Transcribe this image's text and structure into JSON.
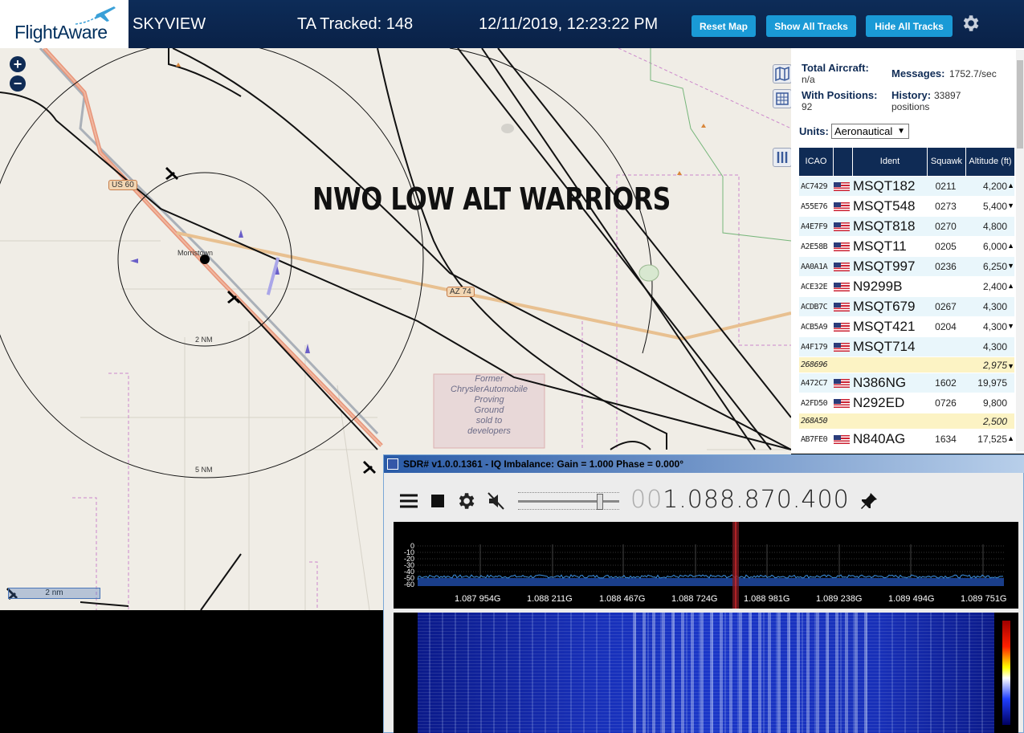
{
  "header": {
    "logo_text": "FlightAware",
    "app_name": "SKYVIEW",
    "tracked_label": "TA Tracked: 148",
    "datetime": "12/11/2019, 12:23:22 PM",
    "buttons": {
      "reset": "Reset Map",
      "show_all": "Show All Tracks",
      "hide_all": "Hide All Tracks"
    },
    "settings_icon": "gear-icon"
  },
  "map": {
    "zoom_in": "+",
    "zoom_out": "−",
    "overlay_title": "NWO LOW ALT WARRIORS",
    "place_label": "Morristown",
    "us60": "US 60",
    "az74": "AZ 74",
    "ring_small": "2 NM",
    "ring_large": "5 NM",
    "scale": "2 nm",
    "proving_ground": [
      "Former",
      "ChryslerAutomobile",
      "Proving",
      "Ground",
      "sold to",
      "developers"
    ]
  },
  "stats": {
    "total_aircraft_label": "Total Aircraft:",
    "total_aircraft_value": "n/a",
    "with_positions_label": "With Positions:",
    "with_positions_value": "92",
    "messages_label": "Messages:",
    "messages_value": "1752.7/sec",
    "history_label": "History:",
    "history_value": "33897",
    "history_unit": "positions",
    "units_label": "Units:",
    "units_value": "Aeronautical"
  },
  "table": {
    "headers": {
      "icao": "ICAO",
      "ident": "Ident",
      "squawk": "Squawk",
      "altitude": "Altitude (ft)"
    },
    "rows": [
      {
        "icao": "AC7429",
        "flag": true,
        "ident": "MSQT182",
        "squawk": "0211",
        "alt": "4,200",
        "trend": "▲"
      },
      {
        "icao": "A55E76",
        "flag": true,
        "ident": "MSQT548",
        "squawk": "0273",
        "alt": "5,400",
        "trend": "▼"
      },
      {
        "icao": "A4E7F9",
        "flag": true,
        "ident": "MSQT818",
        "squawk": "0270",
        "alt": "4,800",
        "trend": ""
      },
      {
        "icao": "A2E58B",
        "flag": true,
        "ident": "MSQT11",
        "squawk": "0205",
        "alt": "6,000",
        "trend": "▲"
      },
      {
        "icao": "AA0A1A",
        "flag": true,
        "ident": "MSQT997",
        "squawk": "0236",
        "alt": "6,250",
        "trend": "▼"
      },
      {
        "icao": "ACE32E",
        "flag": true,
        "ident": "N9299B",
        "squawk": "",
        "alt": "2,400",
        "trend": "▲"
      },
      {
        "icao": "ACDB7C",
        "flag": true,
        "ident": "MSQT679",
        "squawk": "0267",
        "alt": "4,300",
        "trend": ""
      },
      {
        "icao": "ACB5A9",
        "flag": true,
        "ident": "MSQT421",
        "squawk": "0204",
        "alt": "4,300",
        "trend": "▼"
      },
      {
        "icao": "A4F179",
        "flag": true,
        "ident": "MSQT714",
        "squawk": "",
        "alt": "4,300",
        "trend": ""
      },
      {
        "icao": "268696",
        "flag": false,
        "ident": "",
        "squawk": "",
        "alt": "2,975",
        "trend": "▼",
        "highlight": true
      },
      {
        "icao": "A472C7",
        "flag": true,
        "ident": "N386NG",
        "squawk": "1602",
        "alt": "19,975",
        "trend": ""
      },
      {
        "icao": "A2FD50",
        "flag": true,
        "ident": "N292ED",
        "squawk": "0726",
        "alt": "9,800",
        "trend": ""
      },
      {
        "icao": "268A50",
        "flag": false,
        "ident": "",
        "squawk": "",
        "alt": "2,500",
        "trend": "",
        "highlight": true
      },
      {
        "icao": "AB7FE0",
        "flag": true,
        "ident": "N840AG",
        "squawk": "1634",
        "alt": "17,525",
        "trend": "▲"
      }
    ]
  },
  "sdr": {
    "title": "SDR# v1.0.0.1361 - IQ Imbalance: Gain = 1.000 Phase = 0.000°",
    "freq_dim": "00",
    "freq_main": "1.088.870.400",
    "db_labels": [
      "0",
      "-10",
      "-20",
      "-30",
      "-40",
      "-50",
      "-60"
    ],
    "freq_labels": [
      "1.087 954G",
      "1.088 211G",
      "1.088 467G",
      "1.088 724G",
      "1.088 981G",
      "1.089 238G",
      "1.089 494G",
      "1.089 751G"
    ],
    "icons": [
      "menu-icon",
      "stop-icon",
      "gear-icon",
      "mute-icon",
      "pin-icon"
    ],
    "colors": {
      "spectrum_line": "#3b8fe0",
      "marker": "#c0202a"
    }
  }
}
